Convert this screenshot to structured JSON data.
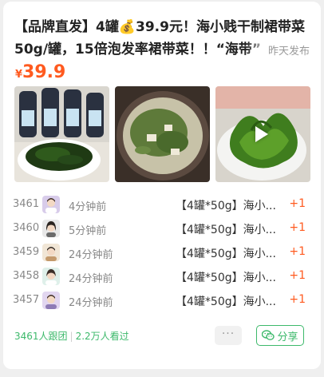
{
  "post": {
    "title": "【品牌直发】4罐💰39.9元！海小贱干制裙带菜50g/罐，15倍泡发率裙带菜！！“海带”",
    "time_tag": "昨天发布",
    "price_symbol": "¥",
    "price": "39.9"
  },
  "media": {
    "video_icon": "play-icon"
  },
  "orders": [
    {
      "rank": "3461",
      "time": "4分钟前",
      "item": "【4罐*50g】海小...",
      "qty": "+1"
    },
    {
      "rank": "3460",
      "time": "5分钟前",
      "item": "【4罐*50g】海小...",
      "qty": "+1"
    },
    {
      "rank": "3459",
      "time": "24分钟前",
      "item": "【4罐*50g】海小...",
      "qty": "+1"
    },
    {
      "rank": "3458",
      "time": "24分钟前",
      "item": "【4罐*50g】海小...",
      "qty": "+1"
    },
    {
      "rank": "3457",
      "time": "24分钟前",
      "item": "【4罐*50g】海小...",
      "qty": "+1"
    }
  ],
  "footer": {
    "followers": "3461人跟团",
    "separator": "|",
    "views": "2.2万人看过",
    "more_label": "···",
    "share_label": "分享",
    "share_icon": "wechat-icon"
  },
  "colors": {
    "accent_orange": "#ff5a1f",
    "accent_green": "#3db96b"
  }
}
